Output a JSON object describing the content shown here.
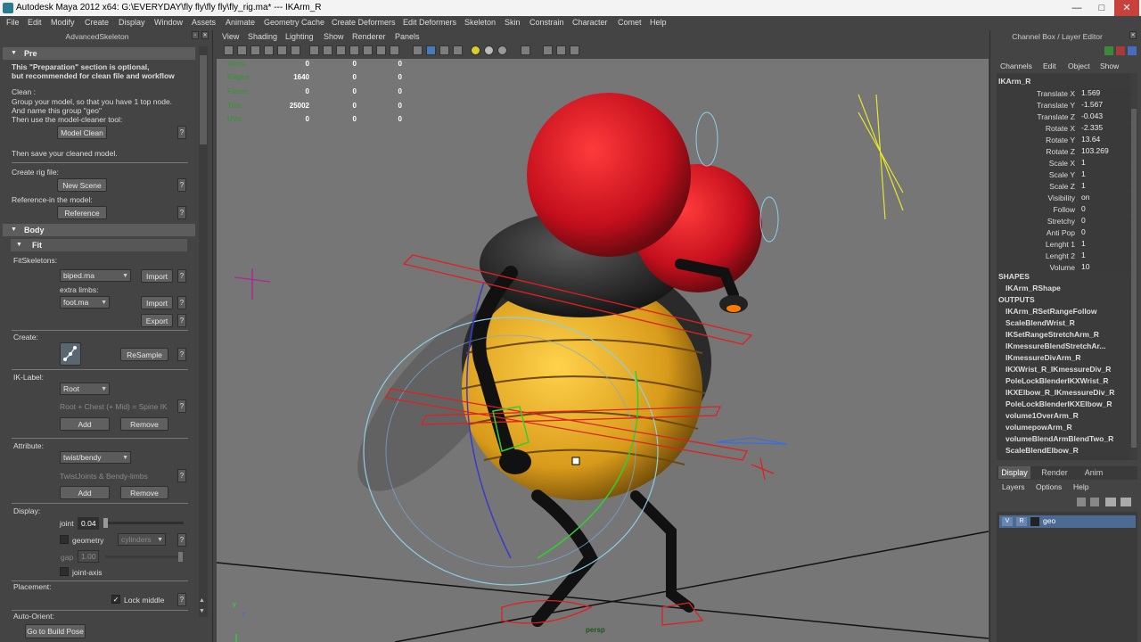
{
  "window": {
    "title": "Autodesk Maya 2012 x64: G:\\EVERYDAY\\fly fly\\fly fly\\fly_rig.ma*   ---   IKArm_R",
    "minimize": "—",
    "maximize": "□",
    "close": "✕"
  },
  "menubar": [
    "File",
    "Edit",
    "Modify",
    "Create",
    "Display",
    "Window",
    "Assets",
    "Animate",
    "Geometry Cache",
    "Create Deformers",
    "Edit Deformers",
    "Skeleton",
    "Skin",
    "Constrain",
    "Character",
    "Comet",
    "Help"
  ],
  "left_panel": {
    "title": "AdvancedSkeleton",
    "pre": {
      "header": "Pre",
      "note1": "This \"Preparation\" section is optional,",
      "note2": "but recommended for clean file and workflow",
      "clean_label": "Clean :",
      "clean1": "Group your model, so that you have 1 top node.",
      "clean2": "And name this group \"geo\"",
      "clean3": "Then use the model-cleaner tool:",
      "model_clean": "Model Clean",
      "save_note": "Then save your cleaned model.",
      "create_rig": "Create rig file:",
      "new_scene": "New Scene",
      "reference_in": "Reference-in the model:",
      "reference": "Reference"
    },
    "body": {
      "header": "Body",
      "fit_header": "Fit",
      "fit_skeletons": "FitSkeletons:",
      "biped": "biped.ma",
      "import1": "Import",
      "extra_limbs": "extra limbs:",
      "foot": "foot.ma",
      "import2": "Import",
      "export": "Export",
      "create": "Create:",
      "resample": "ReSample",
      "ik_label": "IK-Label:",
      "root": "Root",
      "ik_hint": "Root + Chest (+ Mid) = Spine IK",
      "add1": "Add",
      "remove1": "Remove",
      "attribute": "Attribute:",
      "twist": "twist/bendy",
      "attr_hint": "TwistJoints & Bendy-limbs",
      "add2": "Add",
      "remove2": "Remove",
      "display": "Display:",
      "joint": "joint",
      "joint_val": "0.04",
      "geometry": "geometry",
      "cylinders": "cylinders",
      "gap": "gap",
      "gap_val": "1.00",
      "joint_axis": "joint-axis",
      "placement": "Placement:",
      "lock_middle": "Lock middle",
      "auto_orient": "Auto-Orient:",
      "build_pose": "Go to Build Pose"
    },
    "q": "?"
  },
  "viewport": {
    "menu": [
      "View",
      "Shading",
      "Lighting",
      "Show",
      "Renderer",
      "Panels"
    ],
    "hud": [
      {
        "k": "Verts:",
        "a": "0",
        "b": "0",
        "c": "0"
      },
      {
        "k": "Edges:",
        "a": "1640",
        "b": "0",
        "c": "0"
      },
      {
        "k": "Faces:",
        "a": "0",
        "b": "0",
        "c": "0"
      },
      {
        "k": "Tris:",
        "a": "25002",
        "b": "0",
        "c": "0"
      },
      {
        "k": "UVs:",
        "a": "0",
        "b": "0",
        "c": "0"
      }
    ],
    "camera": "persp",
    "axis_y": "y",
    "axis_z": "z"
  },
  "right_panel": {
    "title": "Channel Box / Layer Editor",
    "menu": [
      "Channels",
      "Edit",
      "Object",
      "Show"
    ],
    "object": "IKArm_R",
    "channels": [
      {
        "n": "Translate X",
        "v": "1.569"
      },
      {
        "n": "Translate Y",
        "v": "-1.567"
      },
      {
        "n": "Translate Z",
        "v": "-0.043"
      },
      {
        "n": "Rotate X",
        "v": "-2.335"
      },
      {
        "n": "Rotate Y",
        "v": "13.64"
      },
      {
        "n": "Rotate Z",
        "v": "103.269"
      },
      {
        "n": "Scale X",
        "v": "1"
      },
      {
        "n": "Scale Y",
        "v": "1"
      },
      {
        "n": "Scale Z",
        "v": "1"
      },
      {
        "n": "Visibility",
        "v": "on"
      },
      {
        "n": "Follow",
        "v": "0"
      },
      {
        "n": "Stretchy",
        "v": "0"
      },
      {
        "n": "Anti Pop",
        "v": "0"
      },
      {
        "n": "Lenght 1",
        "v": "1"
      },
      {
        "n": "Lenght 2",
        "v": "1"
      },
      {
        "n": "Volume",
        "v": "10"
      }
    ],
    "shapes_label": "SHAPES",
    "shape": "IKArm_RShape",
    "outputs_label": "OUTPUTS",
    "outputs": [
      "IKArm_RSetRangeFollow",
      "ScaleBlendWrist_R",
      "IKSetRangeStretchArm_R",
      "IKmessureBlendStretchAr...",
      "IKmessureDivArm_R",
      "IKXWrist_R_IKmessureDiv_R",
      "PoleLockBlenderIKXWrist_R",
      "IKXElbow_R_IKmessureDiv_R",
      "PoleLockBlenderIKXElbow_R",
      "volume1OverArm_R",
      "volumepowArm_R",
      "volumeBlendArmBlendTwo_R",
      "ScaleBlendElbow_R"
    ],
    "tabs": [
      "Display",
      "Render",
      "Anim"
    ],
    "layer_menu": [
      "Layers",
      "Options",
      "Help"
    ],
    "layer": {
      "v": "V",
      "r": "R",
      "name": "geo"
    }
  }
}
